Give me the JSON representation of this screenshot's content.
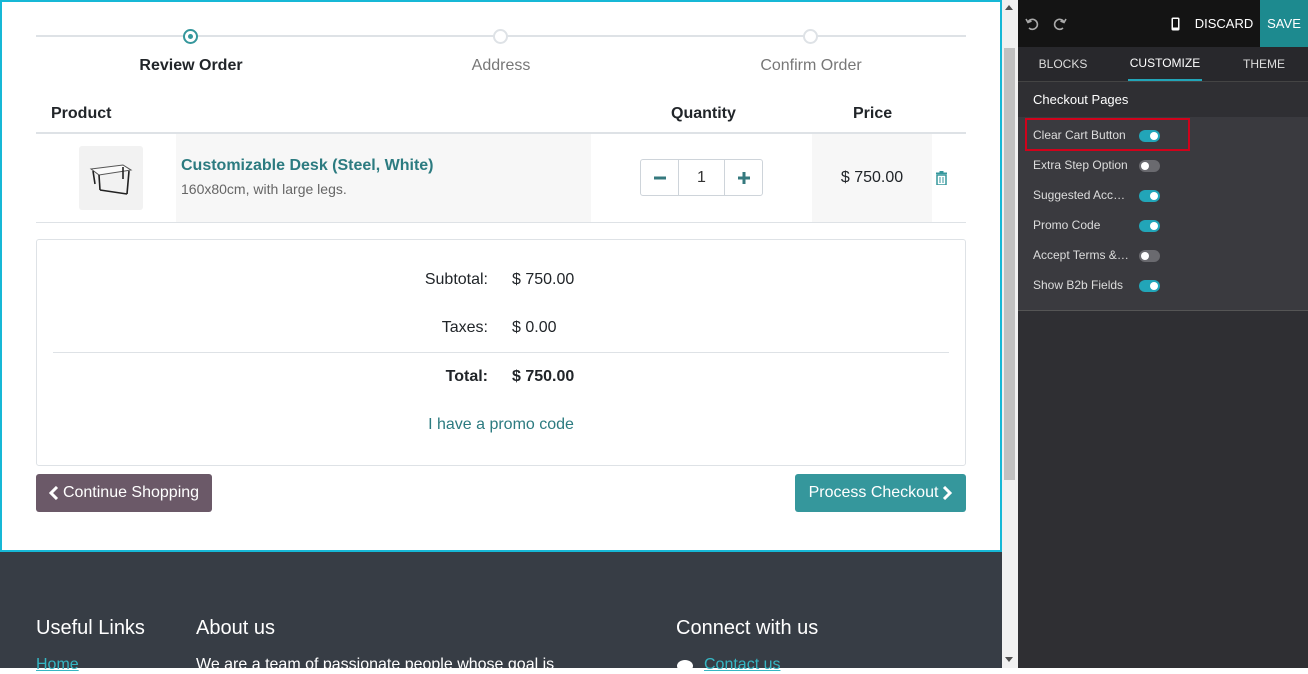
{
  "steps": [
    {
      "label": "Review Order",
      "active": true
    },
    {
      "label": "Address",
      "active": false
    },
    {
      "label": "Confirm Order",
      "active": false
    }
  ],
  "table": {
    "headers": {
      "product": "Product",
      "quantity": "Quantity",
      "price": "Price"
    },
    "row": {
      "name": "Customizable Desk (Steel, White)",
      "description": "160x80cm, with large legs.",
      "quantity": "1",
      "price": "$ 750.00"
    }
  },
  "totals": {
    "subtotal_label": "Subtotal:",
    "subtotal_value": "$ 750.00",
    "taxes_label": "Taxes:",
    "taxes_value": "$ 0.00",
    "total_label": "Total:",
    "total_value": "$ 750.00",
    "promo_link": "I have a promo code"
  },
  "buttons": {
    "continue": "Continue Shopping",
    "checkout": "Process Checkout"
  },
  "footer": {
    "useful_links": "Useful Links",
    "about": "About us",
    "connect": "Connect with us",
    "home_link": "Home",
    "about_text": "We are a team of passionate people whose goal is",
    "contact_link": "Contact us"
  },
  "editor": {
    "discard": "DISCARD",
    "save": "SAVE",
    "tabs": [
      "BLOCKS",
      "CUSTOMIZE",
      "THEME"
    ],
    "active_tab": "CUSTOMIZE",
    "section_title": "Checkout Pages",
    "options": [
      {
        "label": "Clear Cart Button",
        "on": true
      },
      {
        "label": "Extra Step Option",
        "on": false
      },
      {
        "label": "Suggested Accessories",
        "on": true
      },
      {
        "label": "Promo Code",
        "on": true
      },
      {
        "label": "Accept Terms & Conditions",
        "on": false
      },
      {
        "label": "Show B2b Fields",
        "on": true
      }
    ]
  },
  "colors": {
    "accent": "#35979c",
    "highlight_border": "#d0021b",
    "toggle_on": "#22a5b8"
  }
}
